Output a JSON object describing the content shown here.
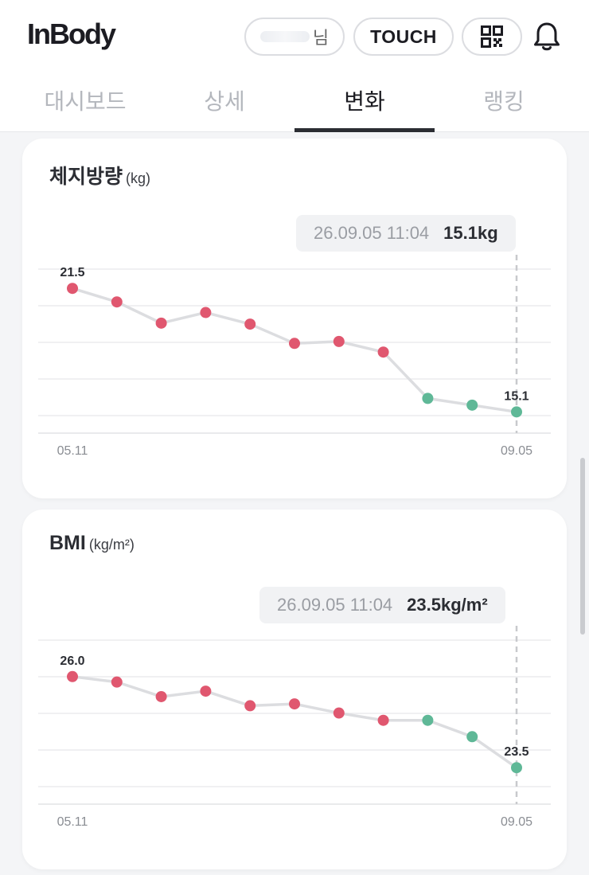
{
  "app": {
    "logo": "InBody"
  },
  "header": {
    "user_suffix": "님",
    "touch_label": "TOUCH"
  },
  "tabs": [
    {
      "label": "대시보드",
      "active": false
    },
    {
      "label": "상세",
      "active": false
    },
    {
      "label": "변화",
      "active": true
    },
    {
      "label": "랭킹",
      "active": false
    }
  ],
  "icons": [
    "qr-code-icon",
    "bell-icon"
  ],
  "colors": {
    "past_point": "#e0576f",
    "recent_point": "#5fb897",
    "line": "#dcdde0"
  },
  "cards": [
    {
      "title": "체지방량",
      "unit": "(kg)",
      "tooltip": {
        "date": "26.09.05 11:04",
        "value": "15.1kg"
      },
      "chart_data": {
        "type": "line",
        "title": "체지방량",
        "ylabel": "(kg)",
        "x_start_label": "05.11",
        "x_end_label": "09.05",
        "values": [
          21.5,
          20.8,
          19.7,
          20.25,
          19.65,
          18.65,
          18.75,
          18.2,
          15.8,
          15.45,
          15.1
        ],
        "recent_from_index": 8,
        "first_label": "21.5",
        "last_label": "15.1",
        "ylim": [
          14.0,
          22.5
        ]
      }
    },
    {
      "title": "BMI",
      "unit": "(kg/m²)",
      "tooltip": {
        "date": "26.09.05 11:04",
        "value": "23.5kg/m²"
      },
      "chart_data": {
        "type": "line",
        "title": "BMI",
        "ylabel": "(kg/m²)",
        "x_start_label": "05.11",
        "x_end_label": "09.05",
        "values": [
          26.0,
          25.85,
          25.45,
          25.6,
          25.2,
          25.25,
          25.0,
          24.8,
          24.8,
          24.35,
          23.5
        ],
        "recent_from_index": 8,
        "first_label": "26.0",
        "last_label": "23.5",
        "ylim": [
          22.5,
          27.0
        ]
      }
    }
  ]
}
